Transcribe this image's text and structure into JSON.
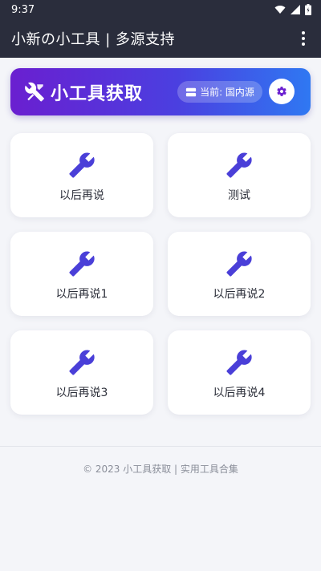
{
  "status_bar": {
    "time": "9:37"
  },
  "app_bar": {
    "title": "小新の小工具 | 多源支持"
  },
  "hero": {
    "title": "小工具获取",
    "source_label": "当前: 国内源"
  },
  "cards": [
    {
      "label": "以后再说"
    },
    {
      "label": "测试"
    },
    {
      "label": "以后再说1"
    },
    {
      "label": "以后再说2"
    },
    {
      "label": "以后再说3"
    },
    {
      "label": "以后再说4"
    }
  ],
  "footer": {
    "text": "© 2023 小工具获取 | 实用工具合集"
  },
  "colors": {
    "app_bar": "#2a2d3c",
    "hero_gradient_start": "#6a1fd0",
    "hero_gradient_end": "#2f78f2",
    "icon_accent": "#4a3fd8",
    "background": "#f4f5f9"
  },
  "icons": {
    "status": [
      "wifi-icon",
      "signal-icon",
      "battery-icon"
    ],
    "hero": "tools-icon",
    "source": "server-icon",
    "settings": "gear-icon",
    "card": "wrench-icon",
    "menu": "more-vert-icon"
  }
}
